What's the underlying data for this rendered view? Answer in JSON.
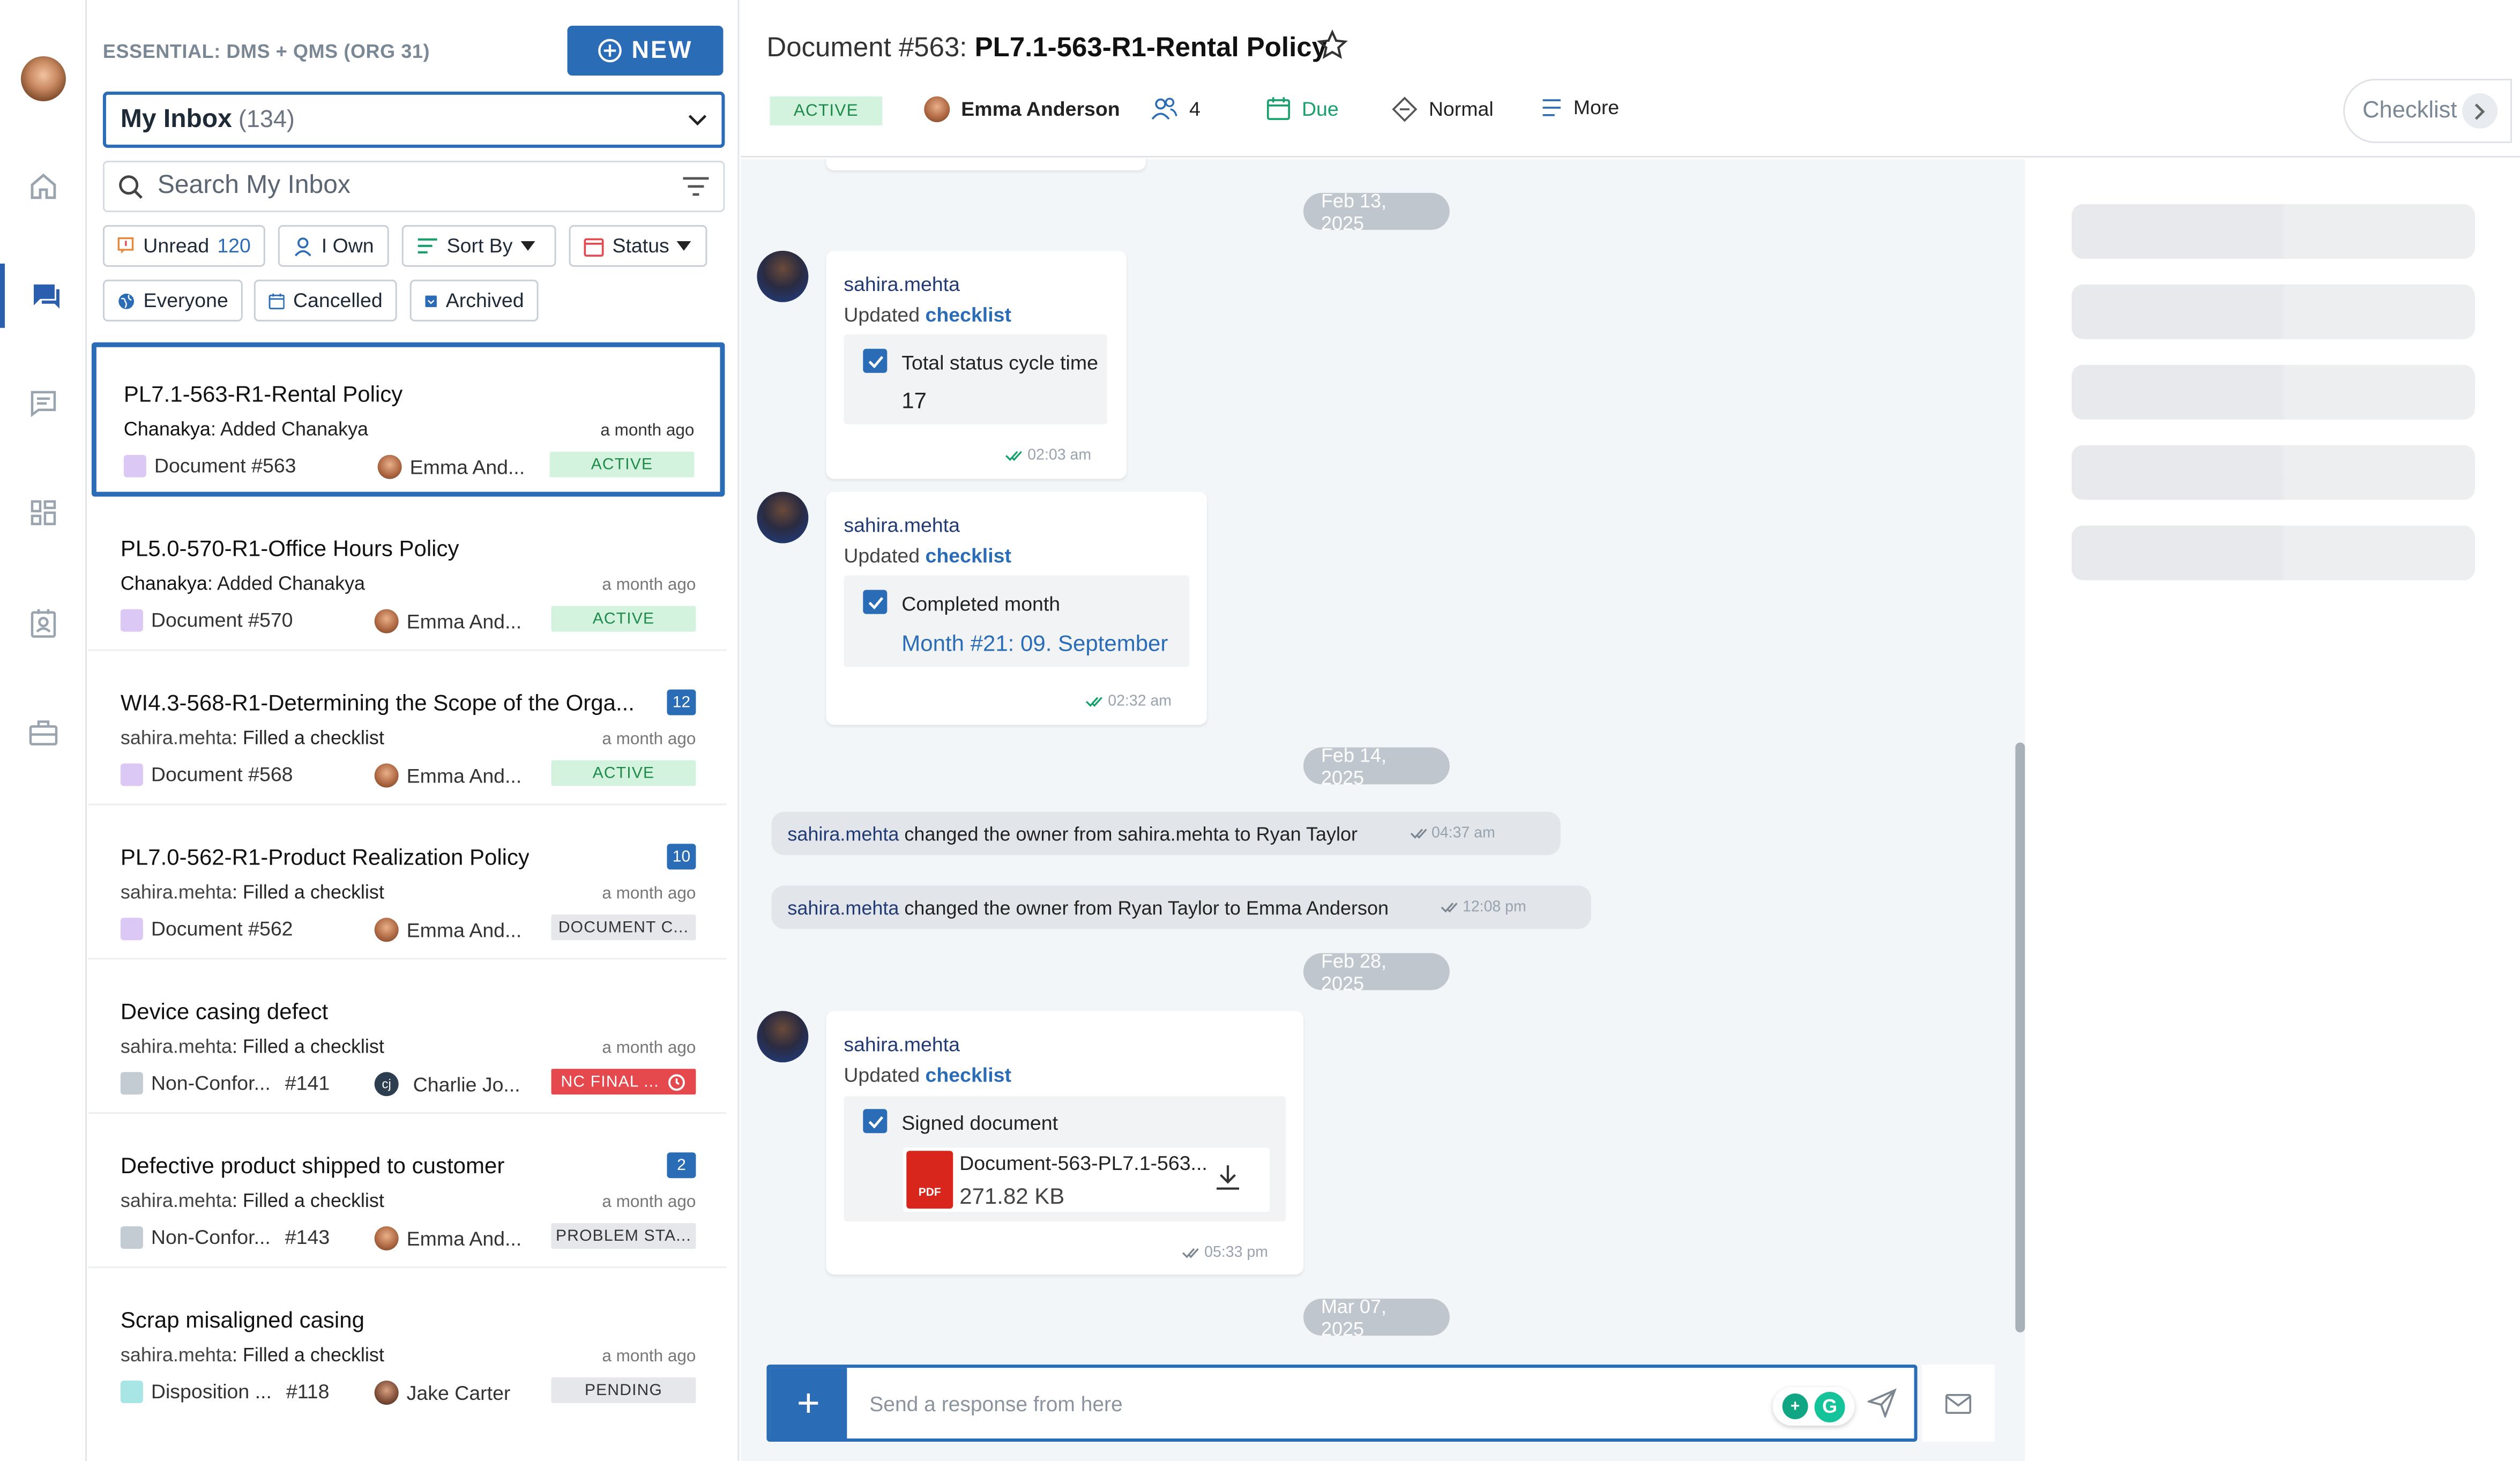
{
  "org_label": "ESSENTIAL: DMS + QMS (ORG 31)",
  "new_button": "NEW",
  "inbox_select": {
    "label": "My Inbox",
    "count": "(134)"
  },
  "search": {
    "placeholder": "Search My Inbox"
  },
  "filters": {
    "unread": "Unread",
    "unread_count": "120",
    "i_own": "I Own",
    "sort_by": "Sort By",
    "status": "Status",
    "everyone": "Everyone",
    "cancelled": "Cancelled",
    "archived": "Archived"
  },
  "cards": [
    {
      "title": "PL7.1-563-R1-Rental Policy",
      "who": "Chanakya",
      "action": ": Added Chanakya",
      "ago": "a month ago",
      "doc": "Document #563",
      "doc_color": "#dcc8f5",
      "owner": "Emma And...",
      "badge": "ACTIVE"
    },
    {
      "title": "PL5.0-570-R1-Office Hours Policy",
      "who": "Chanakya",
      "action": ": Added Chanakya",
      "ago": "a month ago",
      "doc": "Document #570",
      "doc_color": "#dcc8f5",
      "owner": "Emma And...",
      "badge": "ACTIVE"
    },
    {
      "title": "WI4.3-568-R1-Determining the Scope of the Orga...",
      "who": "sahira.mehta",
      "action": ": Filled a checklist",
      "ago": "a month ago",
      "doc": "Document #568",
      "doc_color": "#dcc8f5",
      "owner": "Emma And...",
      "badge": "ACTIVE",
      "unread": "12"
    },
    {
      "title": "PL7.0-562-R1-Product Realization Policy",
      "who": "sahira.mehta",
      "action": ": Filled a checklist",
      "ago": "a month ago",
      "doc": "Document #562",
      "doc_color": "#dcc8f5",
      "owner": "Emma And...",
      "badge": "DOCUMENT C...",
      "unread": "10"
    },
    {
      "title": "Device casing defect",
      "who": "sahira.mehta",
      "action": ": Filled a checklist",
      "ago": "a month ago",
      "doc": "Non-Confor...",
      "doc_num": "#141",
      "doc_color": "#c3cbd3",
      "owner": "Charlie Jo...",
      "owner_initials": "cj",
      "badge": "NC FINAL ..."
    },
    {
      "title": "Defective product shipped to customer",
      "who": "sahira.mehta",
      "action": ": Filled a checklist",
      "ago": "a month ago",
      "doc": "Non-Confor...",
      "doc_num": "#143",
      "doc_color": "#c3cbd3",
      "owner": "Emma And...",
      "badge": "PROBLEM STA...",
      "unread": "2"
    },
    {
      "title": "Scrap misaligned casing",
      "who": "sahira.mehta",
      "action": ": Filled a checklist",
      "ago": "a month ago",
      "doc": "Disposition ...",
      "doc_num": "#118",
      "doc_color": "#a8e6e6",
      "owner": "Jake Carter",
      "badge": "PENDING"
    }
  ],
  "header": {
    "prefix": "Document #563:",
    "title": "PL7.1-563-R1-Rental Policy",
    "status": "ACTIVE",
    "owner": "Emma Anderson",
    "participants": "4",
    "due": "Due",
    "priority": "Normal",
    "more": "More",
    "checklist": "Checklist"
  },
  "chat": {
    "dates": [
      "Feb 13, 2025",
      "Feb 14, 2025",
      "Feb 28, 2025",
      "Mar 07, 2025"
    ],
    "messages": [
      {
        "user": "sahira.mehta",
        "action": "Updated",
        "link": "checklist",
        "field": "Total status cycle time",
        "value": "17",
        "time": "02:03 am"
      },
      {
        "user": "sahira.mehta",
        "action": "Updated",
        "link": "checklist",
        "field": "Completed month",
        "value": "Month #21: 09. September",
        "time": "02:32 am"
      },
      {
        "user": "sahira.mehta",
        "action": "Updated",
        "link": "checklist",
        "field": "Signed document",
        "file_name": "Document-563-PL7.1-563...",
        "file_size": "271.82 KB",
        "file_type": "PDF",
        "time": "05:33 pm"
      }
    ],
    "system": [
      {
        "user": "sahira.mehta",
        "t1": "changed the owner from",
        "from": "sahira.mehta",
        "t2": "to",
        "to": "Ryan Taylor",
        "time": "04:37 am"
      },
      {
        "user": "sahira.mehta",
        "t1": "changed the owner from",
        "from": "Ryan Taylor",
        "t2": "to",
        "to": "Emma Anderson",
        "time": "12:08 pm"
      }
    ],
    "composer_placeholder": "Send a response from here"
  },
  "colors": {
    "accent": "#2a6cb6",
    "active_bg": "#d4f3df",
    "active_fg": "#1e8a4a",
    "nc_red": "#e5484d"
  }
}
